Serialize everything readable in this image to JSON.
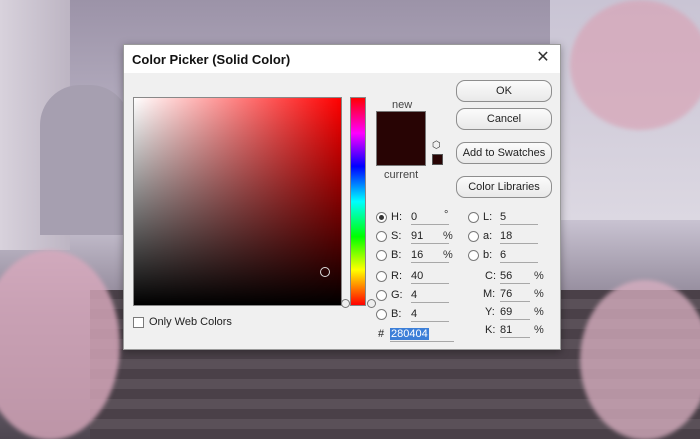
{
  "dialog": {
    "title": "Color Picker (Solid Color)",
    "close_glyph": "✕",
    "selected_color": "#280404"
  },
  "swatch": {
    "new_label": "new",
    "current_label": "current",
    "cube_icon_glyph": "⬡"
  },
  "buttons": {
    "ok": "OK",
    "cancel": "Cancel",
    "add_to_swatches": "Add to Swatches",
    "color_libraries": "Color Libraries"
  },
  "hsb": [
    {
      "label": "H:",
      "value": "0",
      "unit": "°",
      "selected": true
    },
    {
      "label": "S:",
      "value": "91",
      "unit": "%",
      "selected": false
    },
    {
      "label": "B:",
      "value": "16",
      "unit": "%",
      "selected": false
    }
  ],
  "rgb": [
    {
      "label": "R:",
      "value": "40"
    },
    {
      "label": "G:",
      "value": "4"
    },
    {
      "label": "B:",
      "value": "4"
    }
  ],
  "lab": [
    {
      "label": "L:",
      "value": "5"
    },
    {
      "label": "a:",
      "value": "18"
    },
    {
      "label": "b:",
      "value": "6"
    }
  ],
  "cmyk": [
    {
      "label": "C:",
      "value": "56",
      "unit": "%"
    },
    {
      "label": "M:",
      "value": "76",
      "unit": "%"
    },
    {
      "label": "Y:",
      "value": "69",
      "unit": "%"
    },
    {
      "label": "K:",
      "value": "81",
      "unit": "%"
    }
  ],
  "hex": {
    "prefix": "#",
    "value": "280404"
  },
  "web_colors": {
    "label": "Only Web Colors",
    "checked": false
  }
}
